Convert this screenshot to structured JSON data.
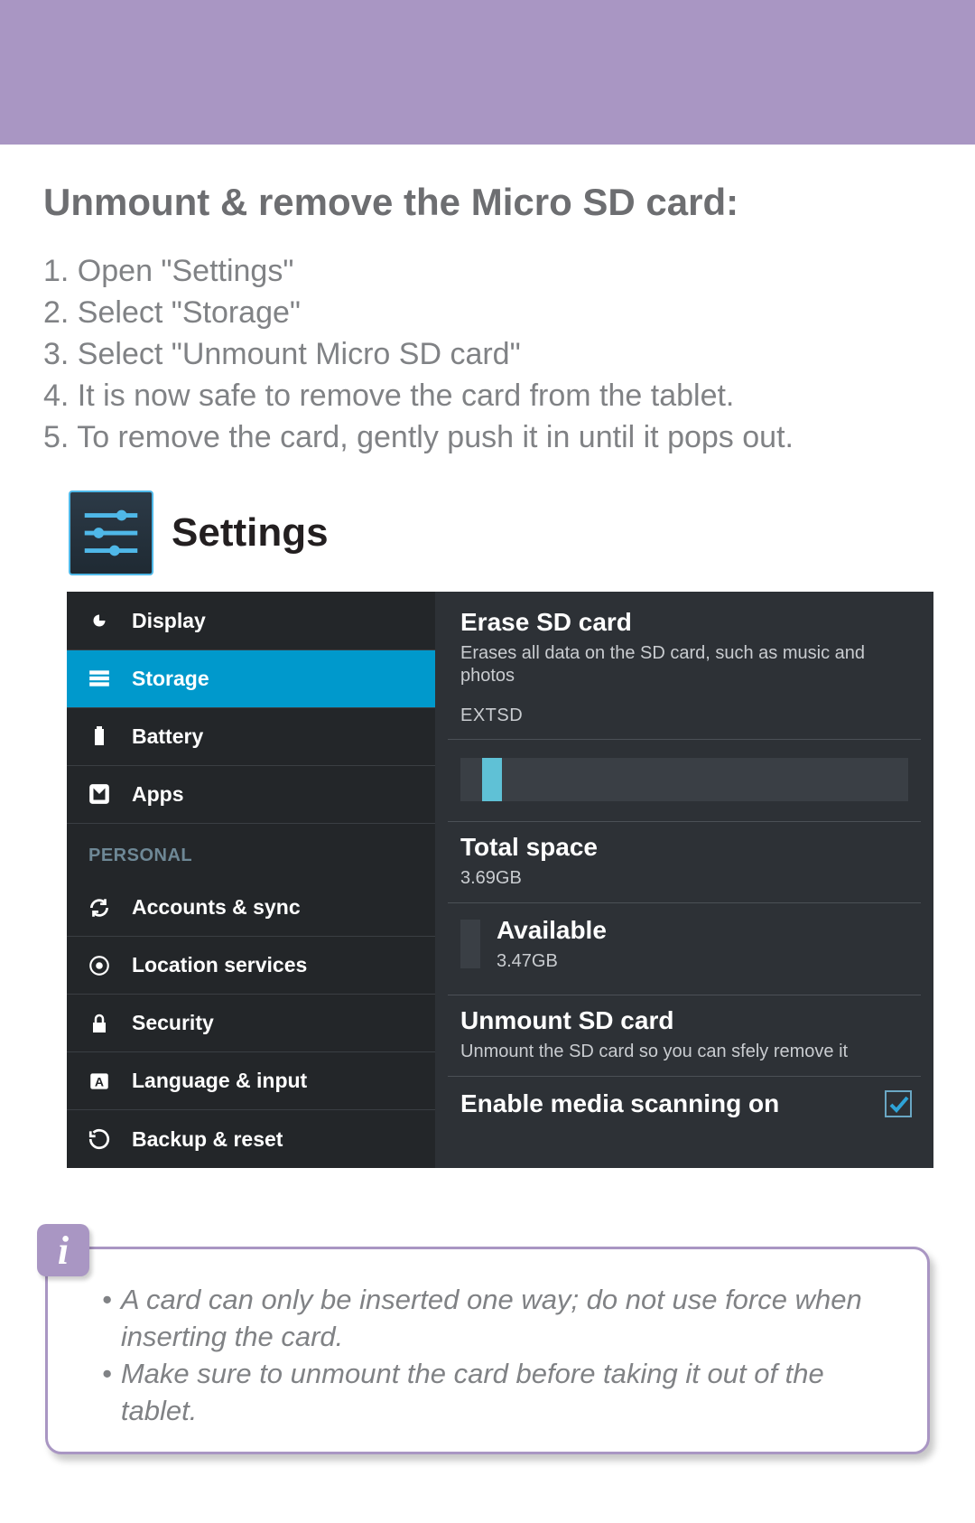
{
  "header": {},
  "title": "Unmount  & remove the Micro SD card:",
  "steps": [
    "1. Open \"Settings\"",
    "2. Select \"Storage\"",
    "3. Select \"Unmount Micro SD card\"",
    "4. It is now safe to remove the card from the tablet.",
    "5. To remove the card, gently push it in until it pops out."
  ],
  "settings_label": "Settings",
  "sidebar": {
    "items": [
      {
        "label": "Display",
        "icon": "display-icon"
      },
      {
        "label": "Storage",
        "icon": "storage-icon",
        "active": true
      },
      {
        "label": "Battery",
        "icon": "battery-icon"
      },
      {
        "label": "Apps",
        "icon": "apps-icon"
      }
    ],
    "section_label": "PERSONAL",
    "personal_items": [
      {
        "label": "Accounts & sync",
        "icon": "sync-icon"
      },
      {
        "label": "Location services",
        "icon": "location-icon"
      },
      {
        "label": "Security",
        "icon": "lock-icon"
      },
      {
        "label": "Language & input",
        "icon": "language-icon"
      },
      {
        "label": "Backup & reset",
        "icon": "backup-icon"
      }
    ]
  },
  "detail": {
    "erase_title": "Erase SD card",
    "erase_sub": "Erases all data on the SD card, such as music and photos",
    "extsd_label": "EXTSD",
    "total_title": "Total space",
    "total_value": "3.69GB",
    "available_title": "Available",
    "available_value": "3.47GB",
    "unmount_title": "Unmount SD card",
    "unmount_sub": "Unmount the SD card so you can sfely remove it",
    "media_title": "Enable media scanning on",
    "media_checked": true
  },
  "info": {
    "badge": "i",
    "bullets": [
      "A card can only be inserted one way; do not use force when inserting the card.",
      "Make sure to unmount the card before taking it out of the tablet."
    ]
  }
}
